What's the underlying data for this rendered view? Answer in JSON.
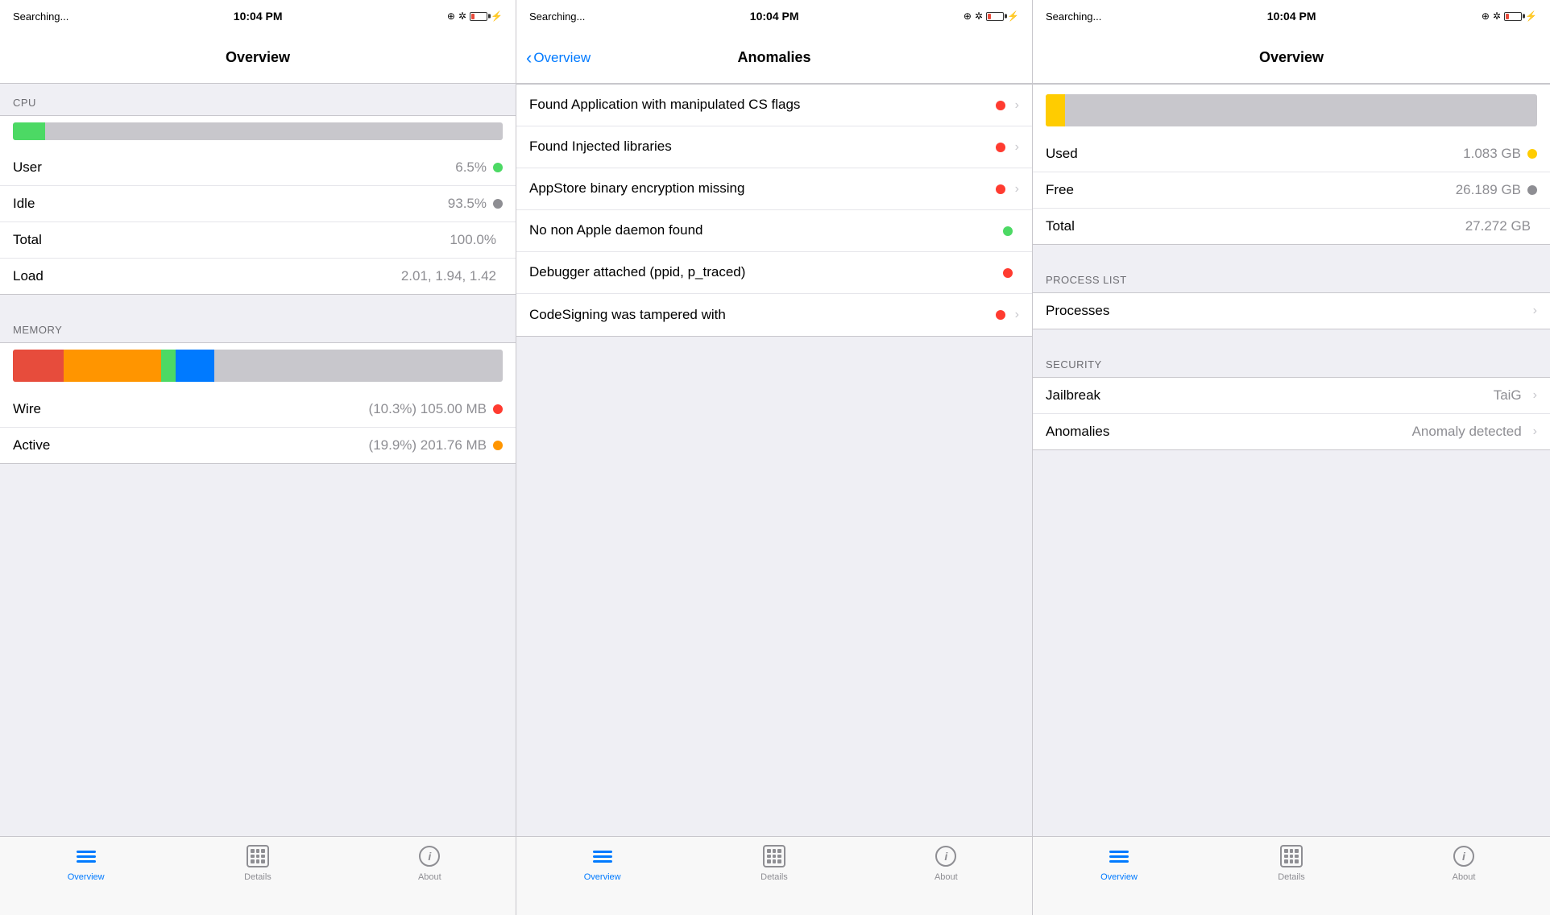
{
  "panels": [
    {
      "id": "panel1",
      "statusBar": {
        "left": "Searching...",
        "center": "10:04 PM",
        "icons": [
          "location",
          "bluetooth",
          "battery",
          "charging"
        ]
      },
      "navTitle": "Overview",
      "sections": [
        {
          "type": "cpu",
          "header": "CPU",
          "barPercent": 6.5,
          "items": [
            {
              "label": "User",
              "value": "6.5%",
              "dot": "green"
            },
            {
              "label": "Idle",
              "value": "93.5%",
              "dot": "gray"
            },
            {
              "label": "Total",
              "value": "100.0%",
              "dot": null
            },
            {
              "label": "Load",
              "value": "2.01, 1.94, 1.42",
              "dot": null
            }
          ]
        },
        {
          "type": "memory",
          "header": "MEMORY",
          "items": [
            {
              "label": "Wire",
              "value": "(10.3%) 105.00 MB",
              "dot": "red"
            },
            {
              "label": "Active",
              "value": "(19.9%) 201.76 MB",
              "dot": "orange"
            }
          ]
        }
      ],
      "tabs": [
        {
          "id": "overview",
          "label": "Overview",
          "active": true
        },
        {
          "id": "details",
          "label": "Details",
          "active": false
        },
        {
          "id": "about",
          "label": "About",
          "active": false
        }
      ]
    },
    {
      "id": "panel2",
      "statusBar": {
        "left": "Searching...",
        "center": "10:04 PM"
      },
      "navBack": "Overview",
      "navTitle": "Anomalies",
      "anomalies": [
        {
          "label": "Found Application with manipulated CS flags",
          "dot": "red",
          "hasChevron": true
        },
        {
          "label": "Found Injected libraries",
          "dot": "red",
          "hasChevron": true
        },
        {
          "label": "AppStore binary encryption missing",
          "dot": "red",
          "hasChevron": true
        },
        {
          "label": "No non Apple daemon found",
          "dot": "green",
          "hasChevron": false
        },
        {
          "label": "Debugger attached (ppid, p_traced)",
          "dot": "red",
          "hasChevron": false
        },
        {
          "label": "CodeSigning was tampered with",
          "dot": "red",
          "hasChevron": true
        }
      ],
      "tabs": [
        {
          "id": "overview",
          "label": "Overview",
          "active": true
        },
        {
          "id": "details",
          "label": "Details",
          "active": false
        },
        {
          "id": "about",
          "label": "About",
          "active": false
        }
      ]
    },
    {
      "id": "panel3",
      "statusBar": {
        "left": "Searching...",
        "center": "10:04 PM"
      },
      "navTitle": "Overview",
      "memorySection": {
        "used": {
          "label": "Used",
          "value": "1.083 GB",
          "dot": "yellow"
        },
        "free": {
          "label": "Free",
          "value": "26.189 GB",
          "dot": "gray"
        },
        "total": {
          "label": "Total",
          "value": "27.272 GB",
          "dot": null
        }
      },
      "processList": {
        "header": "PROCESS LIST",
        "items": [
          {
            "label": "Processes",
            "value": "",
            "hasChevron": true
          }
        ]
      },
      "security": {
        "header": "SECURITY",
        "items": [
          {
            "label": "Jailbreak",
            "value": "TaiG",
            "hasChevron": true
          },
          {
            "label": "Anomalies",
            "value": "Anomaly detected",
            "hasChevron": true
          }
        ]
      },
      "tabs": [
        {
          "id": "overview",
          "label": "Overview",
          "active": true
        },
        {
          "id": "details",
          "label": "Details",
          "active": false
        },
        {
          "id": "about",
          "label": "About",
          "active": false
        }
      ]
    }
  ]
}
